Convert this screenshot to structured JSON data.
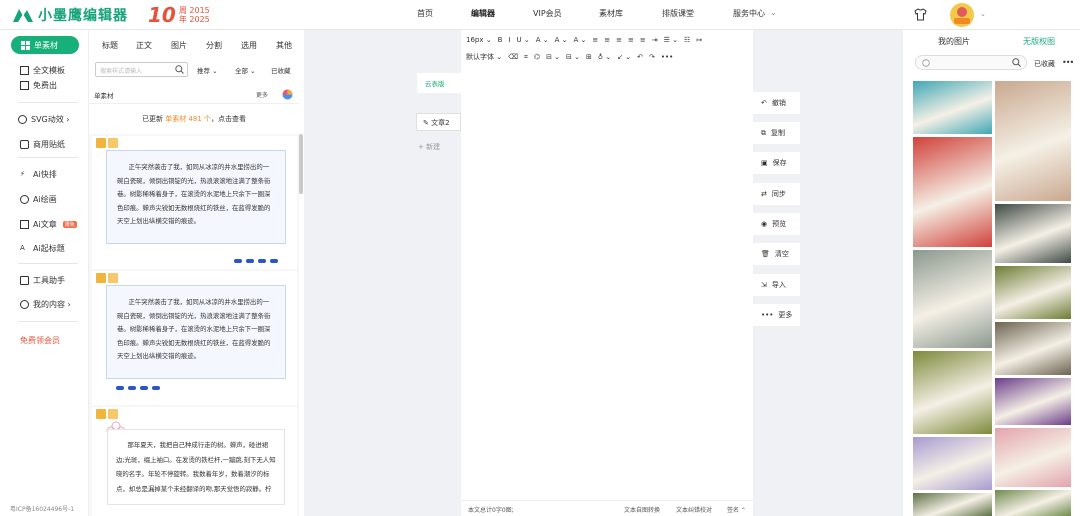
{
  "header": {
    "brand": "小墨鹰编辑器",
    "anniversary": {
      "big": "10",
      "line1": "周 2015",
      "line2": "年 2025"
    },
    "nav": [
      {
        "label": "首页",
        "active": false
      },
      {
        "label": "编辑器",
        "active": true
      },
      {
        "label": "VIP会员",
        "active": false
      },
      {
        "label": "素材库",
        "active": false
      },
      {
        "label": "排版课堂",
        "active": false
      },
      {
        "label": "服务中心",
        "active": false
      }
    ],
    "service_chevron": "⌄"
  },
  "left_sidebar": {
    "active": "单素材",
    "items": [
      {
        "label": "全文模板",
        "icon": "template-icon"
      },
      {
        "label": "免费出",
        "icon": "doc-icon"
      },
      {
        "label": "SVG动效 ›",
        "icon": "svg-icon"
      },
      {
        "label": "商用贴纸",
        "icon": "sticker-icon"
      },
      {
        "label": "Ai快排",
        "icon": "ai-icon"
      },
      {
        "label": "Ai绘画",
        "icon": "palette-icon"
      },
      {
        "label": "Ai文章",
        "icon": "ai-article-icon",
        "badge": "限免"
      },
      {
        "label": "Ai起标题",
        "icon": "ai-title-icon"
      },
      {
        "label": "工具助手",
        "icon": "tools-icon"
      },
      {
        "label": "我的内容 ›",
        "icon": "user-icon"
      }
    ],
    "vip_link": "免费领会员",
    "beian": "粤ICP备16024496号-1"
  },
  "material_panel": {
    "tabs": [
      "标题",
      "正文",
      "图片",
      "分割",
      "选用",
      "其他"
    ],
    "search_placeholder": "搜索样式请输入",
    "filters": [
      "推荐 ⌄",
      "全部 ⌄",
      "已收藏"
    ],
    "section_title": "单素材",
    "more": "更多",
    "notice_prefix": "已更新 ",
    "notice_highlight": "单素材 481 个",
    "notice_suffix": "，点击查看",
    "cards": [
      {
        "text": "正午突然袭击了我，如同从冰凉的井水里捞出的一碗白瓷碗，倾倒出铜锭的光，热浪滚滚地注满了整条街巷。树影稀稀着身子，在滚烫的水泥地上只余下一圈深色印痕。蝉声尖锐如无数根烧红的铁丝，在蓝得发脆的天空上划出纵横交错的痕迹。"
      },
      {
        "text": "正午突然袭击了我，如同从冰凉的井水里捞出的一碗白瓷碗，倾倒出铜锭的光，热浪滚滚地注满了整条街巷。树影稀稀着身子，在滚烫的水泥地上只余下一圈深色印痕。蝉声尖锐如无数根烧红的铁丝，在蓝得发脆的天空上划出纵横交错的痕迹。"
      },
      {
        "text": "那年夏天，我把自己种成行走的树。蝉声，碰进裙边;光斑，缀上袖口。在发烫的铁栏杆,一蹦跳,刻下无人知晓的名字。年轮不停旋转。我数着年岁，数着潮汐的标点，却总是漏掉某个未经翻译的吻,那天觉悟的寂静。柠"
      }
    ]
  },
  "canvas": {
    "doc_label": "云表版",
    "article_tab": "文章2",
    "new_doc": "+ 新建"
  },
  "editor": {
    "toolbar_row1": [
      "16px ⌄",
      "B",
      "I",
      "U ⌄",
      "A ⌄",
      "A ⌄",
      "A ⌄",
      "≡",
      "≡",
      "≡",
      "≡",
      "≡",
      "⇥",
      "☰ ⌄",
      "☷",
      "↦"
    ],
    "toolbar_row2": [
      "默认字体 ⌄",
      "⌫",
      "⌗",
      "⌬",
      "⊟ ⌄",
      "⊟ ⌄",
      "⊞",
      "♁ ⌄",
      "↙ ⌄",
      "↶",
      "↷",
      "•••"
    ],
    "status_left": "本文总计0字0图;",
    "status_mid": "文本自图转换",
    "status_mid2": "文本纠错校对",
    "status_right": "签名 ⌃"
  },
  "actions": [
    {
      "label": "撤销",
      "icon": "undo-icon",
      "glyph": "↶"
    },
    {
      "label": "复制",
      "icon": "copy-icon",
      "glyph": "⧉"
    },
    {
      "label": "保存",
      "icon": "save-icon",
      "glyph": "▣"
    },
    {
      "label": "同步",
      "icon": "sync-icon",
      "glyph": "⇄"
    },
    {
      "label": "预览",
      "icon": "eye-icon",
      "glyph": "◉"
    },
    {
      "label": "清空",
      "icon": "trash-icon",
      "glyph": "🗑"
    },
    {
      "label": "导入",
      "icon": "import-icon",
      "glyph": "⇲"
    },
    {
      "label": "更多",
      "icon": "more-icon",
      "glyph": "•••"
    }
  ],
  "image_panel": {
    "tabs": [
      "我的图片",
      "无版权图"
    ],
    "favorites": "已收藏",
    "more": "•••",
    "search_placeholder": "",
    "images": [
      {
        "name": "teal-flower",
        "color": "#3fa7b5"
      },
      {
        "name": "dried-blossom",
        "color": "#c9a88f"
      },
      {
        "name": "tulips",
        "color": "#d0413a"
      },
      {
        "name": "fir-branch",
        "color": "#3e4a44"
      },
      {
        "name": "snowdrops",
        "color": "#8b988e"
      },
      {
        "name": "man-on-grass",
        "color": "#6d7c34"
      },
      {
        "name": "grass-field",
        "color": "#6b6350"
      },
      {
        "name": "yellow-flowers",
        "color": "#7d8a3a"
      },
      {
        "name": "purple-primrose",
        "color": "#6a3c8a"
      },
      {
        "name": "lavender-blossom",
        "color": "#a79bd1"
      },
      {
        "name": "pink-blossom",
        "color": "#e3a3ad"
      },
      {
        "name": "sunflower",
        "color": "#5d7046"
      },
      {
        "name": "green-leaves",
        "color": "#6f8a4c"
      },
      {
        "name": "pink-cherry",
        "color": "#d88fb0"
      }
    ]
  }
}
